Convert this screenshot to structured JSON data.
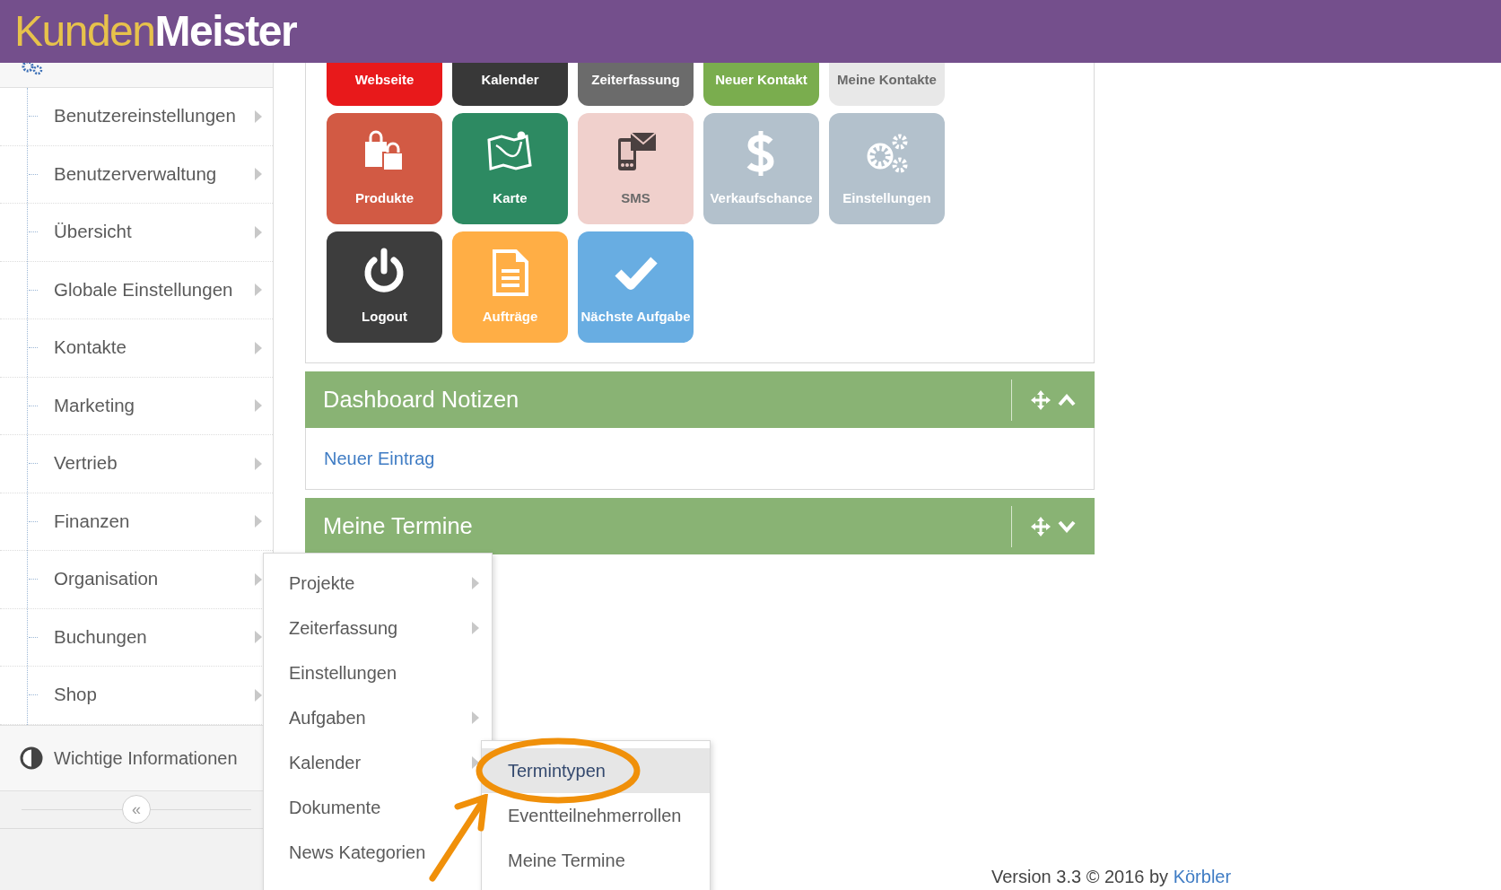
{
  "header": {
    "logo_first": "Kunden",
    "logo_second": "Meister"
  },
  "sidebar": {
    "items": [
      {
        "label": "Benutzereinstellungen",
        "has_submenu": true
      },
      {
        "label": "Benutzerverwaltung",
        "has_submenu": true
      },
      {
        "label": "Übersicht",
        "has_submenu": true
      },
      {
        "label": "Globale Einstellungen",
        "has_submenu": true
      },
      {
        "label": "Kontakte",
        "has_submenu": true
      },
      {
        "label": "Marketing",
        "has_submenu": true
      },
      {
        "label": "Vertrieb",
        "has_submenu": true
      },
      {
        "label": "Finanzen",
        "has_submenu": true
      },
      {
        "label": "Organisation",
        "has_submenu": true
      },
      {
        "label": "Buchungen",
        "has_submenu": true
      },
      {
        "label": "Shop",
        "has_submenu": true
      }
    ],
    "info": "Wichtige Informationen",
    "collapse": "«"
  },
  "tiles": [
    {
      "label": "Webseite",
      "color": "#e8191b"
    },
    {
      "label": "Kalender",
      "color": "#383838"
    },
    {
      "label": "Zeiterfassung",
      "color": "#6b6b6b"
    },
    {
      "label": "Neuer Kontakt",
      "color": "#7aad4e"
    },
    {
      "label": "Meine Kontakte",
      "color": "#e8e8e8"
    },
    {
      "label": "Produkte",
      "color": "#d25a44",
      "kind": "bags"
    },
    {
      "label": "Karte",
      "color": "#2d8a62",
      "kind": "map"
    },
    {
      "label": "SMS",
      "color": "#f0d0cc",
      "kind": "phone-mail"
    },
    {
      "label": "Verkaufschance",
      "color": "#b3c1cc",
      "kind": "dollar"
    },
    {
      "label": "Einstellungen",
      "color": "#b3c1cc",
      "kind": "gears"
    },
    {
      "label": "Logout",
      "color": "#3d3d3d",
      "kind": "power"
    },
    {
      "label": "Aufträge",
      "color": "#ffae45",
      "kind": "document"
    },
    {
      "label": "Nächste Aufgabe",
      "color": "#68ade2",
      "kind": "check"
    }
  ],
  "panels": [
    {
      "title": "Dashboard Notizen",
      "expanded": true,
      "link": "Neuer Eintrag"
    },
    {
      "title": "Meine Termine",
      "expanded": false
    }
  ],
  "flyout": {
    "items": [
      {
        "label": "Projekte",
        "has_submenu": true
      },
      {
        "label": "Zeiterfassung",
        "has_submenu": true
      },
      {
        "label": "Einstellungen",
        "has_submenu": false
      },
      {
        "label": "Aufgaben",
        "has_submenu": true
      },
      {
        "label": "Kalender",
        "has_submenu": true
      },
      {
        "label": "Dokumente",
        "has_submenu": false
      },
      {
        "label": "News Kategorien",
        "has_submenu": false
      }
    ]
  },
  "submenu": {
    "items": [
      {
        "label": "Termintypen",
        "selected": true
      },
      {
        "label": "Eventteilnehmerrollen",
        "selected": false
      },
      {
        "label": "Meine Termine",
        "selected": false
      }
    ]
  },
  "footer": {
    "text": "Version 3.3 © 2016 by ",
    "link": "Körbler"
  }
}
